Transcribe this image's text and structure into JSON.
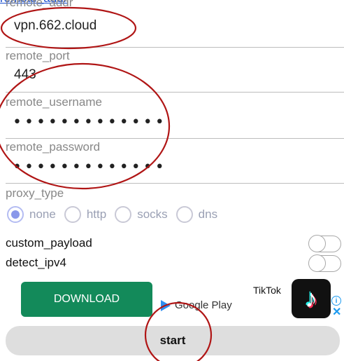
{
  "top_link": {
    "text": "remote_addr"
  },
  "fields": {
    "remote_addr": {
      "label": "remote_addr",
      "value": "vpn.662.cloud"
    },
    "remote_port": {
      "label": "remote_port",
      "value": "443"
    },
    "remote_username": {
      "label": "remote_username",
      "value": "•••••••••••••"
    },
    "remote_password": {
      "label": "remote_password",
      "value": "•••••••••••••"
    }
  },
  "proxy": {
    "label": "proxy_type",
    "options": [
      "none",
      "http",
      "socks",
      "dns"
    ],
    "selected": "none"
  },
  "switches": {
    "custom_payload": {
      "label": "custom_payload",
      "on": false
    },
    "detect_ipv4": {
      "label": "detect_ipv4",
      "on": false
    }
  },
  "ad": {
    "button_label": "DOWNLOAD",
    "store_label": "Google Play",
    "app_name": "TikTok",
    "info_icon": "info-icon",
    "close_icon": "close-icon",
    "button_color": "#138a5a"
  },
  "start_label": "start",
  "colors": {
    "annotation": "#b01515",
    "link": "#1a4fd1",
    "radio_selected": "#8a98ea"
  }
}
